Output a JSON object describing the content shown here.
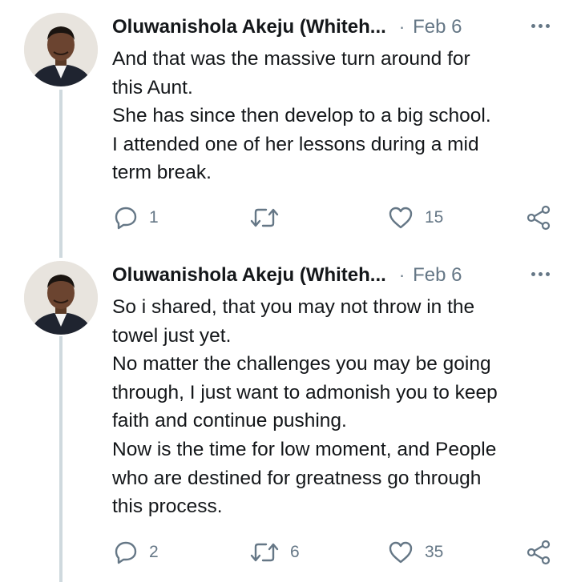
{
  "tweets": [
    {
      "author": "Oluwanishola Akeju (Whiteh...",
      "date": "Feb 6",
      "separator": "·",
      "avatar_icon": "profile-photo",
      "lines": [
        "And that was the massive turn around for",
        "this Aunt.",
        "She has since then develop to a big school.",
        "I attended one of her lessons during a mid",
        "term break."
      ],
      "reply_count": "1",
      "retweet_count": "",
      "like_count": "15"
    },
    {
      "author": "Oluwanishola Akeju (Whiteh...",
      "date": "Feb 6",
      "separator": "·",
      "avatar_icon": "profile-photo",
      "lines": [
        "So i shared, that you may not throw in the",
        "towel just yet.",
        "No matter the challenges you may be going",
        "through, I just want to admonish you to keep",
        "faith and continue pushing.",
        "Now is the time for low moment, and People",
        "who are destined for greatness go through",
        "this process."
      ],
      "reply_count": "2",
      "retweet_count": "6",
      "like_count": "35"
    }
  ],
  "icons": {
    "reply": "comment-bubble-icon",
    "retweet": "retweet-icon",
    "like": "heart-icon",
    "share": "share-icon",
    "more": "more-dots-icon"
  },
  "colors": {
    "text": "#14171a",
    "secondary": "#657786",
    "thread_line": "#cfd9de",
    "background": "#ffffff"
  }
}
